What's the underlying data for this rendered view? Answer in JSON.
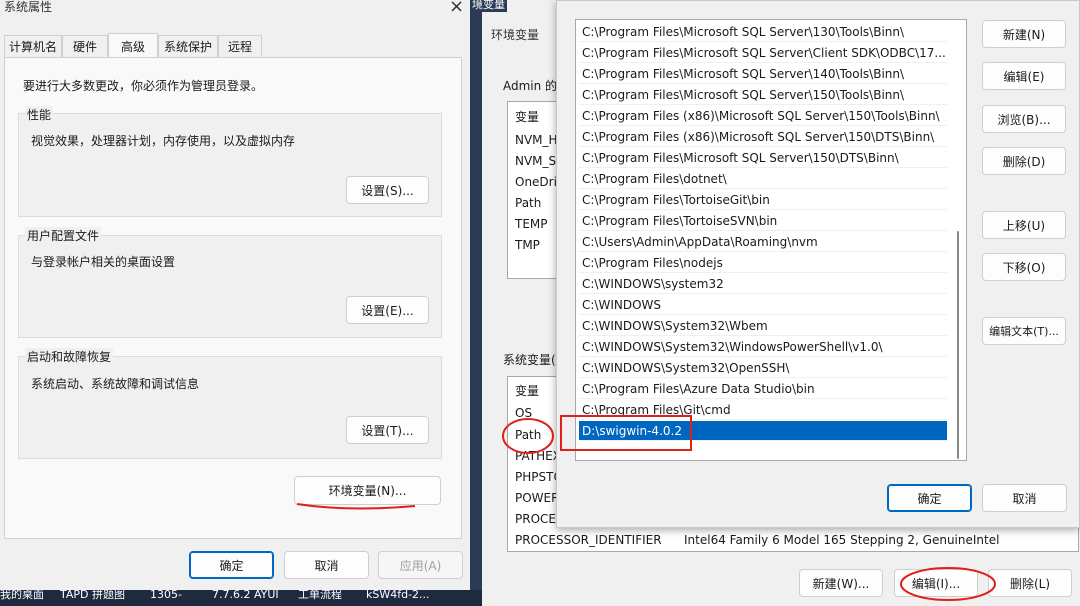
{
  "sysprops": {
    "title": "系统属性",
    "close_glyph": "×",
    "tabs": [
      "计算机名",
      "硬件",
      "高级",
      "系统保护",
      "远程"
    ],
    "notice": "要进行大多数更改，你必须作为管理员登录。",
    "perf": {
      "title": "性能",
      "desc": "视觉效果，处理器计划，内存使用，以及虚拟内存",
      "button": "设置(S)..."
    },
    "profile": {
      "title": "用户配置文件",
      "desc": "与登录帐户相关的桌面设置",
      "button": "设置(E)..."
    },
    "startup": {
      "title": "启动和故障恢复",
      "desc": "系统启动、系统故障和调试信息",
      "button": "设置(T)..."
    },
    "env_button": "环境变量(N)...",
    "ok": "确定",
    "cancel": "取消",
    "apply": "应用(A)"
  },
  "envvars": {
    "title_fragment": "境变量",
    "title_left": "环境变量",
    "user_section_label": "Admin 的",
    "user_header": "变量",
    "user_vars": [
      "NVM_H",
      "NVM_S",
      "OneDri",
      "Path",
      "TEMP",
      "TMP"
    ],
    "system_section_label": "系统变量(",
    "system_header": "变量",
    "system_vars": [
      "OS",
      "Path",
      "PATHEX",
      "PHPSTO",
      "POWER",
      "PROCE"
    ],
    "last_row_name": "PROCESSOR_IDENTIFIER",
    "last_row_value": "Intel64 Family 6 Model 165 Stepping 2, GenuineIntel",
    "new_button": "新建(W)...",
    "edit_button": "编辑(I)...",
    "delete_button": "删除(L)"
  },
  "editpath": {
    "entries": [
      "C:\\Program Files\\Microsoft SQL Server\\130\\Tools\\Binn\\",
      "C:\\Program Files\\Microsoft SQL Server\\Client SDK\\ODBC\\17...",
      "C:\\Program Files\\Microsoft SQL Server\\140\\Tools\\Binn\\",
      "C:\\Program Files\\Microsoft SQL Server\\150\\Tools\\Binn\\",
      "C:\\Program Files (x86)\\Microsoft SQL Server\\150\\Tools\\Binn\\",
      "C:\\Program Files (x86)\\Microsoft SQL Server\\150\\DTS\\Binn\\",
      "C:\\Program Files\\Microsoft SQL Server\\150\\DTS\\Binn\\",
      "C:\\Program Files\\dotnet\\",
      "C:\\Program Files\\TortoiseGit\\bin",
      "C:\\Program Files\\TortoiseSVN\\bin",
      "C:\\Users\\Admin\\AppData\\Roaming\\nvm",
      "C:\\Program Files\\nodejs",
      "C:\\WINDOWS\\system32",
      "C:\\WINDOWS",
      "C:\\WINDOWS\\System32\\Wbem",
      "C:\\WINDOWS\\System32\\WindowsPowerShell\\v1.0\\",
      "C:\\WINDOWS\\System32\\OpenSSH\\",
      "C:\\Program Files\\Azure Data Studio\\bin",
      "C:\\Program Files\\Git\\cmd",
      "D:\\swigwin-4.0.2"
    ],
    "selected_index": 19,
    "buttons": {
      "new": "新建(N)",
      "edit": "编辑(E)",
      "browse": "浏览(B)...",
      "delete": "删除(D)",
      "up": "上移(U)",
      "down": "下移(O)",
      "edit_text": "编辑文本(T)..."
    },
    "ok": "确定",
    "cancel": "取消"
  },
  "taskbar": [
    "我的桌面",
    "TAPD 拼题图",
    "1305-",
    "7.7.6.2 AYUI",
    "工单流程",
    "kSW4fd-2..."
  ],
  "annotation_color": "#e0201a",
  "accent_color": "#0067c0"
}
